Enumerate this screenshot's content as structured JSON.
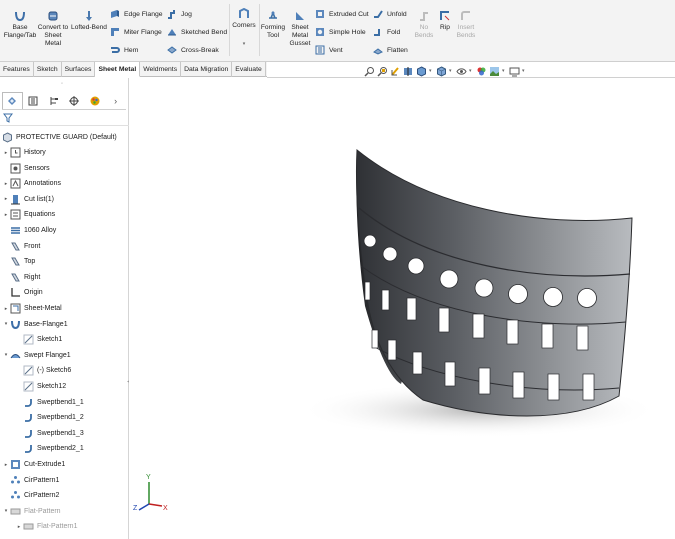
{
  "ribbon": {
    "buttons": [
      {
        "id": "base-flange",
        "label": "Base Flange/Tab",
        "enabled": true
      },
      {
        "id": "convert-to-sheet-metal",
        "label": "Convert to Sheet Metal",
        "enabled": true
      },
      {
        "id": "lofted-bend",
        "label": "Lofted-Bend",
        "enabled": true
      },
      {
        "id": "corners",
        "label": "Corners",
        "enabled": true
      },
      {
        "id": "forming-tool",
        "label": "Forming Tool",
        "enabled": true
      },
      {
        "id": "sheet-metal-gusset",
        "label": "Sheet Metal Gusset",
        "enabled": true
      },
      {
        "id": "no-bends",
        "label": "No Bends",
        "enabled": false
      },
      {
        "id": "rip",
        "label": "Rip",
        "enabled": true
      },
      {
        "id": "insert-bends",
        "label": "Insert Bends",
        "enabled": false
      }
    ],
    "rows": [
      {
        "id": "edge-flange",
        "label": "Edge Flange",
        "enabled": true
      },
      {
        "id": "miter-flange",
        "label": "Miter Flange",
        "enabled": true
      },
      {
        "id": "hem",
        "label": "Hem",
        "enabled": true
      },
      {
        "id": "jog",
        "label": "Jog",
        "enabled": true
      },
      {
        "id": "sketched-bend",
        "label": "Sketched Bend",
        "enabled": true
      },
      {
        "id": "cross-break",
        "label": "Cross-Break",
        "enabled": true
      },
      {
        "id": "extruded-cut",
        "label": "Extruded Cut",
        "enabled": true
      },
      {
        "id": "simple-hole",
        "label": "Simple Hole",
        "enabled": true
      },
      {
        "id": "vent",
        "label": "Vent",
        "enabled": true
      },
      {
        "id": "unfold",
        "label": "Unfold",
        "enabled": true
      },
      {
        "id": "fold",
        "label": "Fold",
        "enabled": true
      },
      {
        "id": "flatten",
        "label": "Flatten",
        "enabled": true
      }
    ]
  },
  "tabs": [
    {
      "label": "Features",
      "active": false
    },
    {
      "label": "Sketch",
      "active": false
    },
    {
      "label": "Surfaces",
      "active": false
    },
    {
      "label": "Sheet Metal",
      "active": true
    },
    {
      "label": "Weldments",
      "active": false
    },
    {
      "label": "Data Migration",
      "active": false
    },
    {
      "label": "Evaluate",
      "active": false
    }
  ],
  "panel": {
    "root": "PROTECTIVE GUARD  (Default)",
    "tree": [
      {
        "label": "History",
        "icon": "history-icon",
        "expander": true,
        "indent": 0
      },
      {
        "label": "Sensors",
        "icon": "sensor-icon",
        "expander": false,
        "indent": 0
      },
      {
        "label": "Annotations",
        "icon": "annotations-icon",
        "expander": true,
        "indent": 0
      },
      {
        "label": "Cut list(1)",
        "icon": "cut-list-icon",
        "expander": true,
        "indent": 0
      },
      {
        "label": "Equations",
        "icon": "equations-icon",
        "expander": true,
        "indent": 0
      },
      {
        "label": "1060 Alloy",
        "icon": "material-icon",
        "expander": false,
        "indent": 0
      },
      {
        "label": "Front",
        "icon": "plane-icon",
        "expander": false,
        "indent": 0
      },
      {
        "label": "Top",
        "icon": "plane-icon",
        "expander": false,
        "indent": 0
      },
      {
        "label": "Right",
        "icon": "plane-icon",
        "expander": false,
        "indent": 0
      },
      {
        "label": "Origin",
        "icon": "origin-icon",
        "expander": false,
        "indent": 0
      },
      {
        "label": "Sheet-Metal",
        "icon": "sheet-metal-icon",
        "expander": true,
        "indent": 0
      },
      {
        "label": "Base-Flange1",
        "icon": "base-flange-icon",
        "expander": true,
        "expanded": true,
        "indent": 0
      },
      {
        "label": "Sketch1",
        "icon": "sketch-icon",
        "expander": false,
        "indent": 1
      },
      {
        "label": "Swept Flange1",
        "icon": "swept-flange-icon",
        "expander": true,
        "expanded": true,
        "indent": 0
      },
      {
        "label": "(-) Sketch6",
        "icon": "sketch-icon",
        "expander": false,
        "indent": 1
      },
      {
        "label": "Sketch12",
        "icon": "sketch-icon",
        "expander": false,
        "indent": 1
      },
      {
        "label": "Sweptbend1_1",
        "icon": "bend-icon",
        "expander": false,
        "indent": 1
      },
      {
        "label": "Sweptbend1_2",
        "icon": "bend-icon",
        "expander": false,
        "indent": 1
      },
      {
        "label": "Sweptbend1_3",
        "icon": "bend-icon",
        "expander": false,
        "indent": 1
      },
      {
        "label": "Sweptbend2_1",
        "icon": "bend-icon",
        "expander": false,
        "indent": 1
      },
      {
        "label": "Cut-Extrude1",
        "icon": "cut-extrude-icon",
        "expander": true,
        "indent": 0
      },
      {
        "label": "CirPattern1",
        "icon": "circular-pattern-icon",
        "expander": false,
        "indent": 0
      },
      {
        "label": "CirPattern2",
        "icon": "circular-pattern-icon",
        "expander": false,
        "indent": 0
      },
      {
        "label": "Flat-Pattern",
        "icon": "flat-pattern-icon",
        "expander": true,
        "expanded": true,
        "indent": 0,
        "dim": true
      },
      {
        "label": "Flat-Pattern1",
        "icon": "flat-pattern-icon",
        "expander": true,
        "indent": 1,
        "dim": true
      }
    ]
  },
  "triad": {
    "x": "X",
    "y": "Y",
    "z": "Z"
  },
  "colors": {
    "accent": "#1f6fc5",
    "model_dark": "#3a3c40",
    "model_light": "#a4a7ab"
  }
}
